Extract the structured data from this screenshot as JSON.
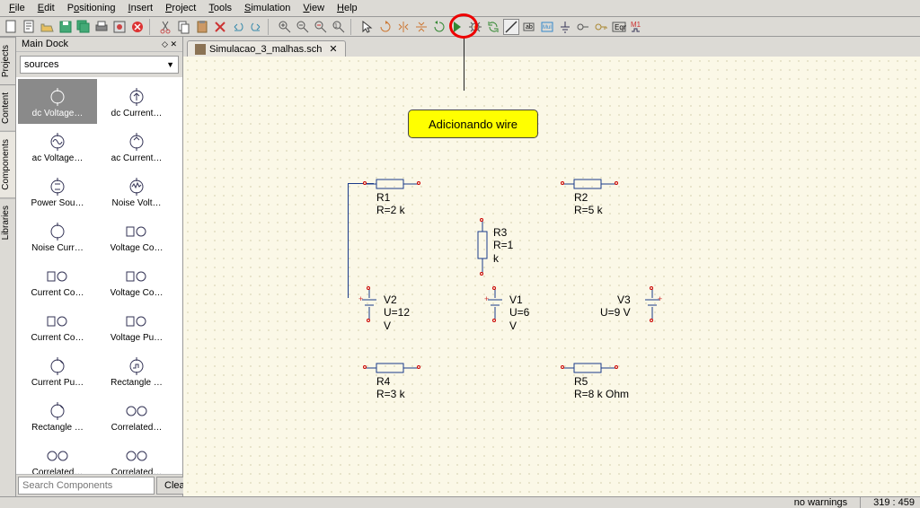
{
  "menu": {
    "file": "File",
    "edit": "Edit",
    "positioning": "Positioning",
    "insert": "Insert",
    "project": "Project",
    "tools": "Tools",
    "simulation": "Simulation",
    "view": "View",
    "help": "Help"
  },
  "dock": {
    "title": "Main Dock",
    "category": "sources",
    "search_placeholder": "Search Components",
    "clear": "Clear",
    "items": [
      {
        "label": "dc Voltage…"
      },
      {
        "label": "dc Current…"
      },
      {
        "label": "ac Voltage…"
      },
      {
        "label": "ac Current…"
      },
      {
        "label": "Power Sou…"
      },
      {
        "label": "Noise Volt…"
      },
      {
        "label": "Noise Curr…"
      },
      {
        "label": "Voltage Co…"
      },
      {
        "label": "Current Co…"
      },
      {
        "label": "Voltage Co…"
      },
      {
        "label": "Current Co…"
      },
      {
        "label": "Voltage Pu…"
      },
      {
        "label": "Current Pu…"
      },
      {
        "label": "Rectangle …"
      },
      {
        "label": "Rectangle …"
      },
      {
        "label": "Correlated…"
      },
      {
        "label": "Correlated…"
      },
      {
        "label": "Correlated…"
      }
    ]
  },
  "side_tabs": {
    "projects": "Projects",
    "content": "Content",
    "components": "Components",
    "libraries": "Libraries"
  },
  "tab": {
    "name": "Simulacao_3_malhas.sch"
  },
  "callout": "Adicionando wire",
  "schematic": {
    "r1": {
      "name": "R1",
      "value": "R=2 k"
    },
    "r2": {
      "name": "R2",
      "value": "R=5 k"
    },
    "r3": {
      "name": "R3",
      "value": "R=1 k"
    },
    "r4": {
      "name": "R4",
      "value": "R=3 k"
    },
    "r5": {
      "name": "R5",
      "value": "R=8 k Ohm"
    },
    "v1": {
      "name": "V1",
      "value": "U=6 V"
    },
    "v2": {
      "name": "V2",
      "value": "U=12 V"
    },
    "v3": {
      "name": "V3",
      "value": "U=9 V"
    }
  },
  "status": {
    "warnings": "no warnings",
    "coords": "319 : 459"
  }
}
